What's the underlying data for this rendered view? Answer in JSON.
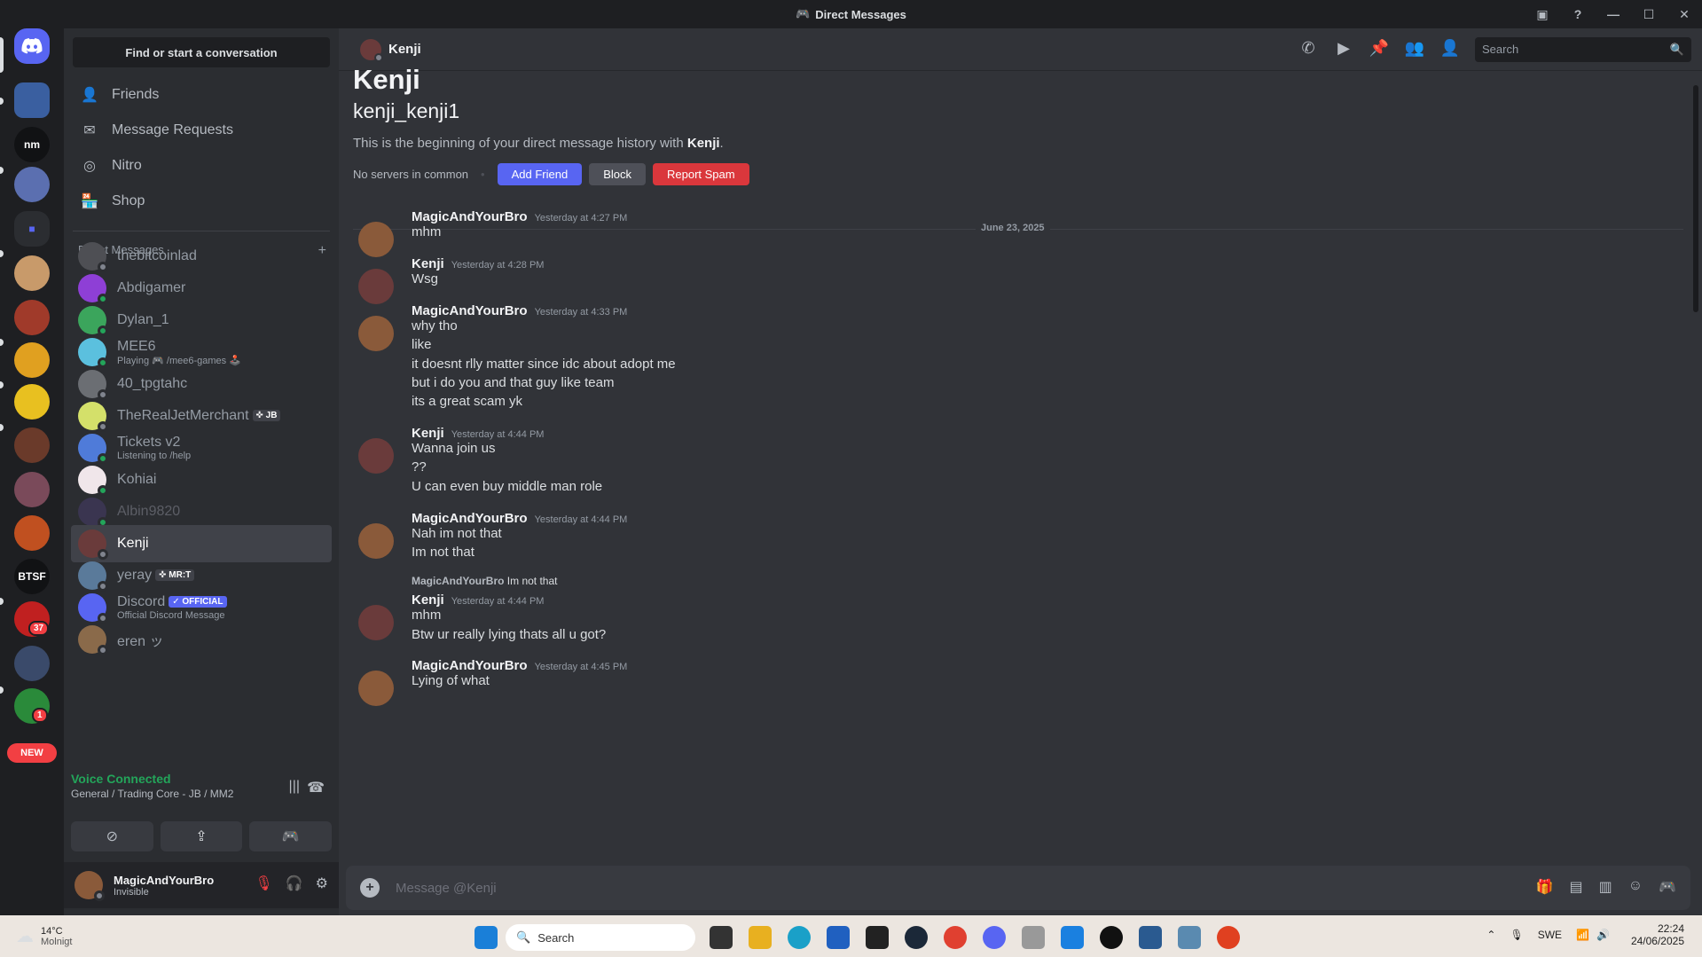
{
  "window": {
    "title": "Direct Messages"
  },
  "guilds": {
    "nm": "nm",
    "btsf": "BTSF",
    "new": "NEW",
    "badge_37": "37",
    "badge_1": "1"
  },
  "sidebar": {
    "find": "Find or start a conversation",
    "nav": [
      "Friends",
      "Message Requests",
      "Nitro",
      "Shop"
    ],
    "dm_header": "Direct Messages",
    "add": "+",
    "dms": [
      {
        "name": "thebitcoinlad",
        "sub": "",
        "tag": "",
        "color": "#4e4f54"
      },
      {
        "name": "Abdigamer",
        "sub": "",
        "tag": "",
        "color": "#8e3fd6"
      },
      {
        "name": "Dylan_1",
        "sub": "",
        "tag": "",
        "color": "#3ba55c"
      },
      {
        "name": "MEE6",
        "sub": "Playing 🎮 /mee6-games 🕹️",
        "tag": "",
        "color": "#5bc0de"
      },
      {
        "name": "40_tpgtahc",
        "sub": "",
        "tag": "",
        "color": "#6b6e73"
      },
      {
        "name": "TheRealJetMerchant",
        "sub": "",
        "tag": "✜ JB",
        "color": "#d4e06a"
      },
      {
        "name": "Tickets v2",
        "sub": "Listening to /help",
        "tag": "",
        "color": "#4f7bd9"
      },
      {
        "name": "Kohiai",
        "sub": "",
        "tag": "",
        "color": "#f0e6ea"
      },
      {
        "name": "Albin9820",
        "sub": "",
        "tag": "",
        "color": "#3a3550"
      },
      {
        "name": "Kenji",
        "sub": "",
        "tag": "",
        "color": "#6a3b3b"
      },
      {
        "name": "yeray",
        "sub": "",
        "tag": "✜ MR:T",
        "color": "#5a7a9a"
      },
      {
        "name": "Discord",
        "sub": "Official Discord Message",
        "tag": "✓ OFFICIAL",
        "color": "#5865f2"
      },
      {
        "name": "eren ッ",
        "sub": "",
        "tag": "",
        "color": "#8a6a4a"
      }
    ]
  },
  "voice": {
    "status": "Voice Connected",
    "channel": "General / Trading Core - JB / MM2"
  },
  "user": {
    "name": "MagicAndYourBro",
    "status": "Invisible"
  },
  "header": {
    "name": "Kenji",
    "search_placeholder": "Search"
  },
  "profile": {
    "display": "Kenji",
    "username": "kenji_kenji1",
    "intro_prefix": "This is the beginning of your direct message history with",
    "intro_name": "Kenji",
    "intro_suffix": ".",
    "common": "No servers in common",
    "add_friend": "Add Friend",
    "block": "Block",
    "report": "Report Spam"
  },
  "divider": "June 23, 2025",
  "messages": [
    {
      "author": "MagicAndYourBro",
      "time": "Yesterday at 4:27 PM",
      "lines": [
        "mhm"
      ]
    },
    {
      "author": "Kenji",
      "time": "Yesterday at 4:28 PM",
      "lines": [
        "Wsg"
      ]
    },
    {
      "author": "MagicAndYourBro",
      "time": "Yesterday at 4:33 PM",
      "lines": [
        "why tho",
        "like",
        "it doesnt rlly matter since idc about adopt me",
        "but i do you and that guy like team",
        "its a great scam yk"
      ]
    },
    {
      "author": "Kenji",
      "time": "Yesterday at 4:44 PM",
      "lines": [
        "Wanna join us",
        "??",
        "U can even buy middle man role"
      ]
    },
    {
      "author": "MagicAndYourBro",
      "time": "Yesterday at 4:44 PM",
      "lines": [
        "Nah im not that",
        "Im not that"
      ]
    },
    {
      "author": "Kenji",
      "time": "Yesterday at 4:44 PM",
      "lines": [
        "mhm",
        "Btw ur really lying thats all u got?"
      ],
      "reply_author": "MagicAndYourBro",
      "reply_text": "Im not that"
    },
    {
      "author": "MagicAndYourBro",
      "time": "Yesterday at 4:45 PM",
      "lines": [
        "Lying of what"
      ]
    }
  ],
  "composer": {
    "placeholder": "Message @Kenji"
  },
  "taskbar": {
    "temp": "14°C",
    "weather": "Molnigt",
    "search": "Search",
    "lang": "SWE",
    "time": "22:24",
    "date": "24/06/2025"
  }
}
